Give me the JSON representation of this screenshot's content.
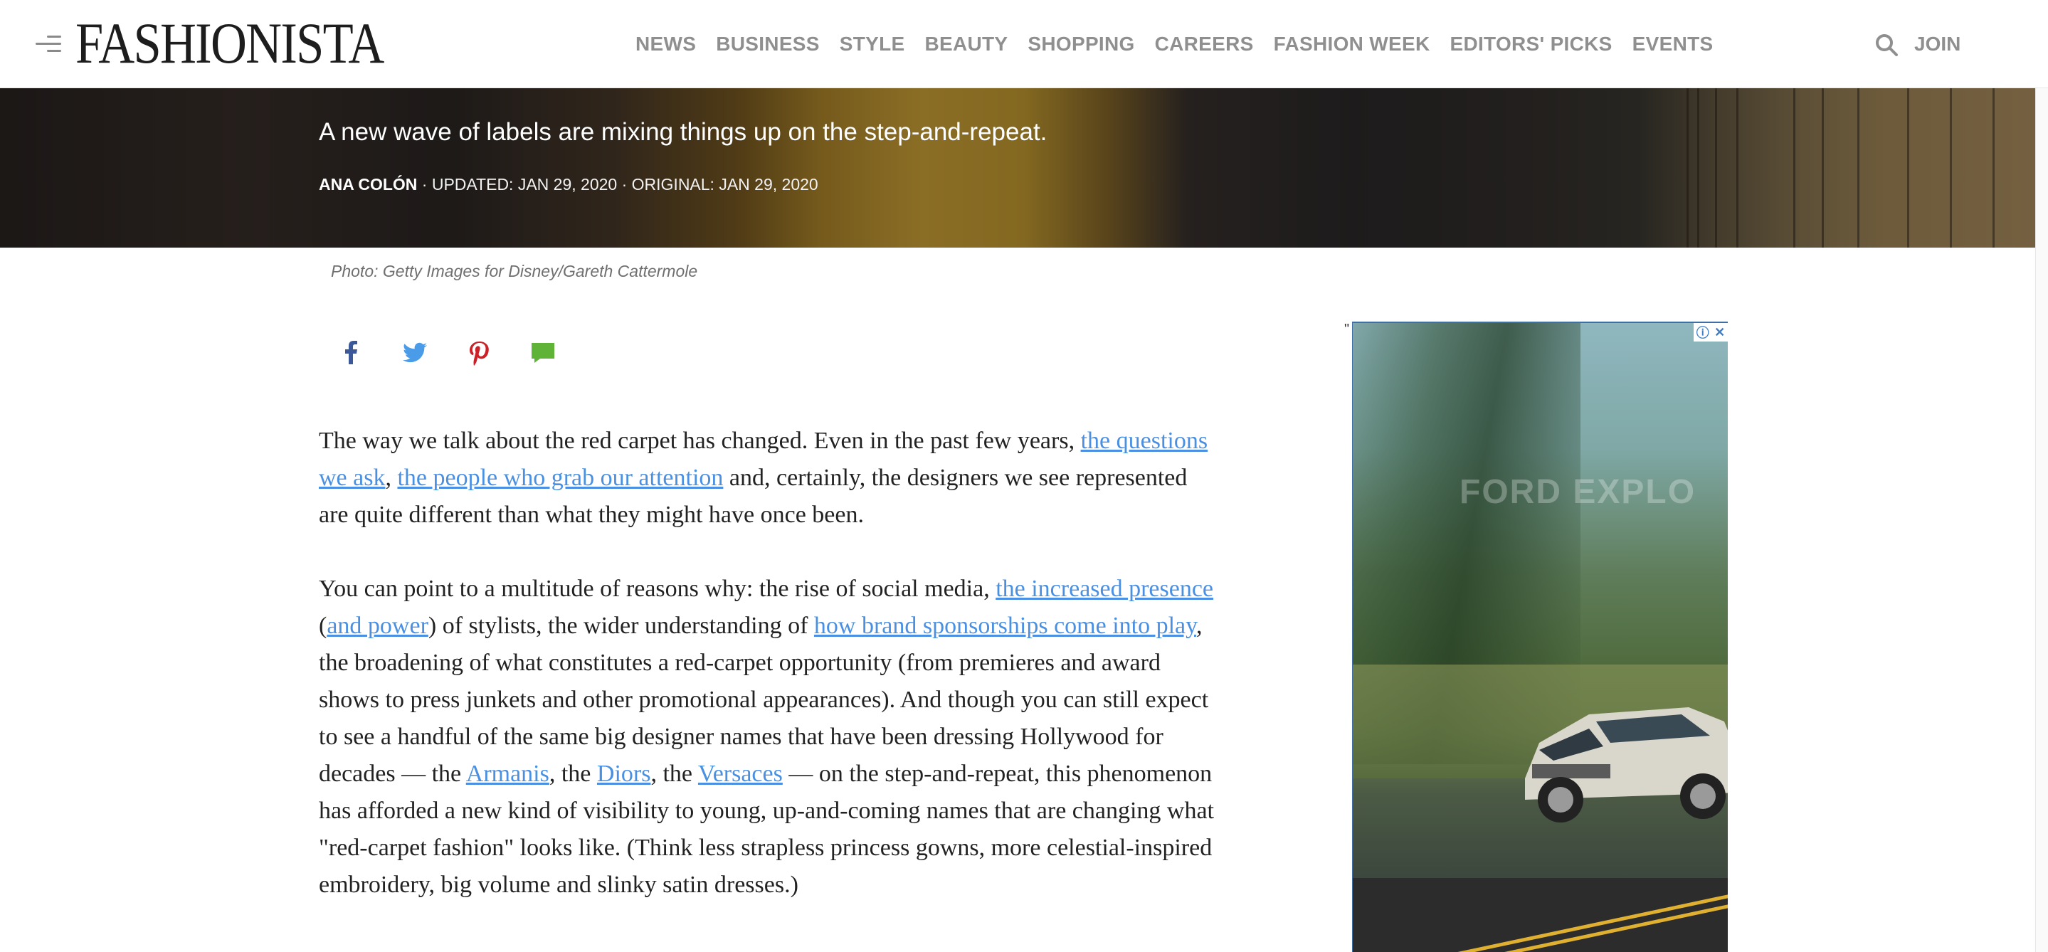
{
  "header": {
    "logo": "FASHIONISTA",
    "nav": [
      "NEWS",
      "BUSINESS",
      "STYLE",
      "BEAUTY",
      "SHOPPING",
      "CAREERS",
      "FASHION WEEK",
      "EDITORS' PICKS",
      "EVENTS"
    ],
    "join_label": "JOIN"
  },
  "hero": {
    "subtitle": "A new wave of labels are mixing things up on the step-and-repeat.",
    "author": "ANA COLÓN",
    "updated": " · UPDATED: JAN 29, 2020 · ORIGINAL: JAN 29, 2020"
  },
  "caption": "Photo: Getty Images for Disney/Gareth Cattermole",
  "share": {
    "facebook": "facebook-icon",
    "twitter": "twitter-icon",
    "pinterest": "pinterest-icon",
    "comments": "comment-icon"
  },
  "article": {
    "p1": {
      "t1": "The way we talk about the red carpet has changed. Even in the past few years, ",
      "l1": "the questions we ask",
      "t2": ", ",
      "l2": "the people who grab our attention",
      "t3": " and, certainly, the designers we see represented are quite different than what they might have once been."
    },
    "p2": {
      "t1": "You can point to a multitude of reasons why: the rise of social media, ",
      "l1": "the increased presence",
      "t2": " (",
      "l2": "and power",
      "t3": ") of stylists, the wider understanding of ",
      "l3": "how brand sponsorships come into play",
      "t4": ", the broadening of what constitutes a red-carpet opportunity (from premieres and award shows to press junkets and other promotional appearances). And though you can still expect to see a handful of the same big designer names that have been dressing Hollywood for decades — the ",
      "l4": "Armanis",
      "t5": ", the ",
      "l5": "Diors",
      "t6": ", the ",
      "l6": "Versaces",
      "t7": " — on the step-and-repeat, this phenomenon has afforded a new kind of visibility to young, up-and-coming names that are changing what \"red-carpet fashion\" looks like. (Think less strapless princess gowns, more celestial-inspired embroidery, big volume and slinky satin dresses.)"
    }
  },
  "ad": {
    "quote": "\"",
    "overlay_text": "FORD EXPLO",
    "info_glyph": "ⓘ",
    "close_glyph": "✕"
  },
  "colors": {
    "link": "#4a90e2",
    "nav": "#8f8f8f",
    "facebook": "#3b5998",
    "twitter": "#4a9be8",
    "pinterest": "#cb2027",
    "comment": "#5fb336"
  }
}
